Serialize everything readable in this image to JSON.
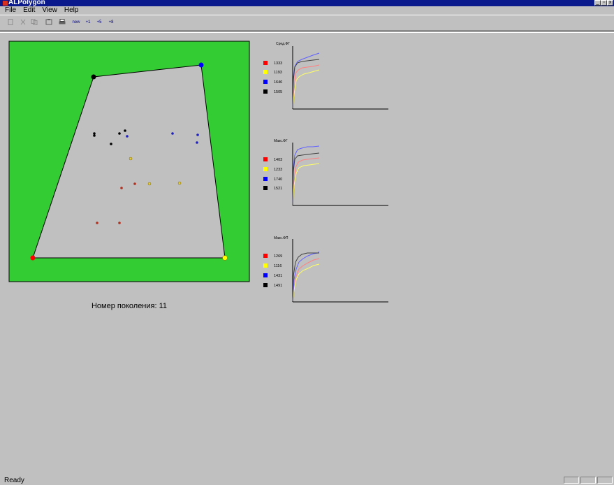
{
  "window": {
    "title": "ALPolygon",
    "min": "_",
    "max": "▫",
    "close": "x"
  },
  "menu": {
    "items": [
      "File",
      "Edit",
      "View",
      "Help"
    ]
  },
  "toolbar": {
    "new_label": "new",
    "step1": "+1",
    "step5": "+5",
    "step10": "+8"
  },
  "generation": {
    "label": "Номер поколения:",
    "value": "11"
  },
  "charts": [
    {
      "title": "Сред.ФГ",
      "legend": [
        {
          "color": "#ff0000",
          "value": "1333"
        },
        {
          "color": "#ffff00",
          "value": "1193"
        },
        {
          "color": "#0000ff",
          "value": "1646"
        },
        {
          "color": "#000000",
          "value": "1505"
        }
      ]
    },
    {
      "title": "Макс.ФГ",
      "legend": [
        {
          "color": "#ff0000",
          "value": "1403"
        },
        {
          "color": "#ffff00",
          "value": "1233"
        },
        {
          "color": "#0000ff",
          "value": "1740"
        },
        {
          "color": "#000000",
          "value": "1521"
        }
      ]
    },
    {
      "title": "Макс.ФП",
      "legend": [
        {
          "color": "#ff0000",
          "value": "1269"
        },
        {
          "color": "#ffff00",
          "value": "1116"
        },
        {
          "color": "#0000ff",
          "value": "1431"
        },
        {
          "color": "#000000",
          "value": "1491"
        }
      ]
    }
  ],
  "status": {
    "text": "Ready"
  },
  "colors": {
    "field": "#33cc33",
    "polygon": "#c0c0c0",
    "title_bg": "#0a1a8c"
  }
}
